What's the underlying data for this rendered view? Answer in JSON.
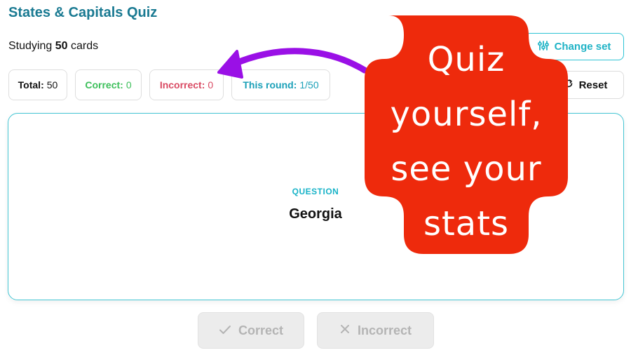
{
  "header": {
    "title": "States & Capitals Quiz",
    "studying_prefix": "Studying",
    "studying_count": "50",
    "studying_suffix": "cards"
  },
  "toolbar": {
    "change_set_label": "Change set",
    "change_set_icon": "sliders-icon",
    "reset_label": "Reset",
    "reset_icon": "refresh-icon"
  },
  "stats": {
    "total_label": "Total:",
    "total_value": "50",
    "correct_label": "Correct:",
    "correct_value": "0",
    "incorrect_label": "Incorrect:",
    "incorrect_value": "0",
    "round_label": "This round:",
    "round_value": "1/50"
  },
  "card": {
    "label": "QUESTION",
    "text": "Georgia"
  },
  "answers": {
    "correct_label": "Correct",
    "incorrect_label": "Incorrect"
  },
  "overlay": {
    "lines": [
      "Quiz",
      "yourself,",
      "see your",
      "stats"
    ]
  },
  "colors": {
    "title": "#1a7a92",
    "accent": "#1fb3c6",
    "correct": "#3cbf5a",
    "incorrect": "#d94a63",
    "overlay_bg": "#ee2a0c",
    "arrow": "#9a10e6"
  }
}
